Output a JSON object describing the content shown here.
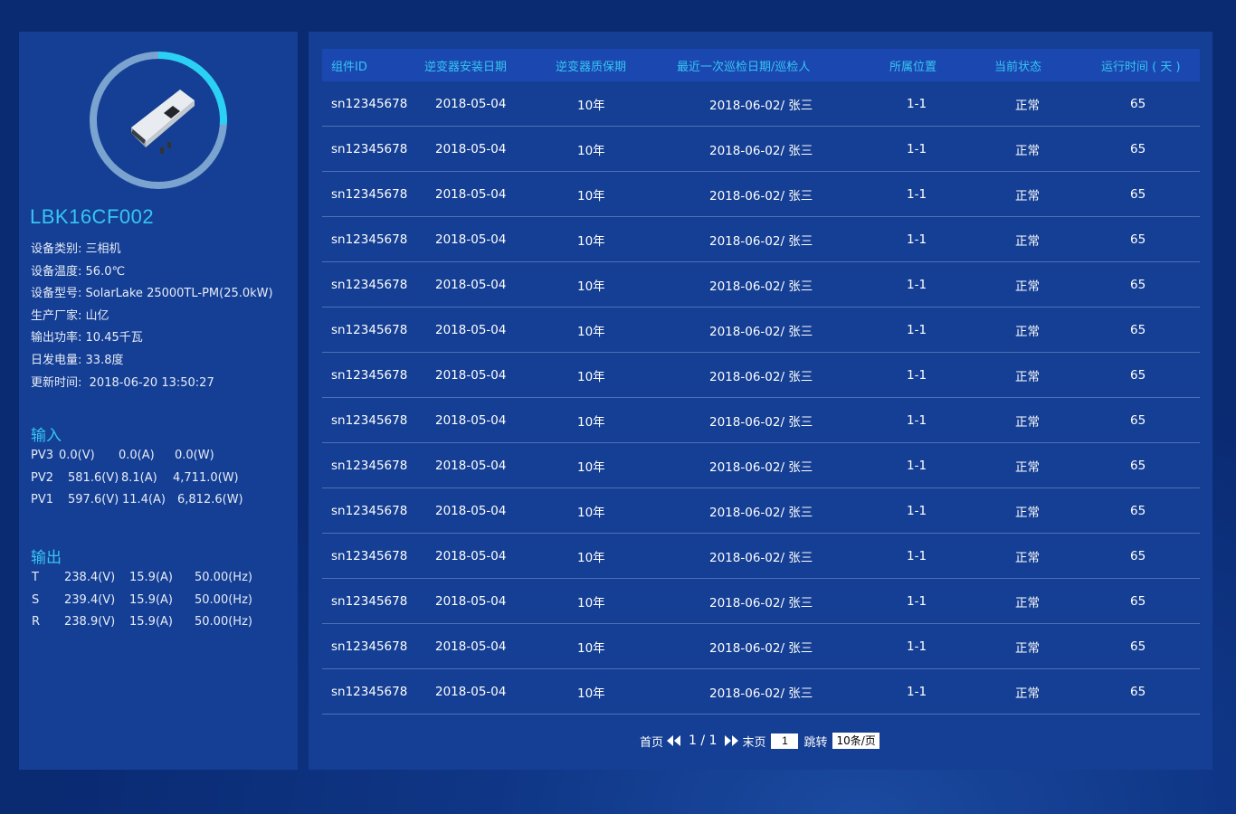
{
  "device": {
    "name": "LBK16CF002",
    "info": [
      {
        "label": "设备类别:",
        "value": "三相机"
      },
      {
        "label": "设备温度:",
        "value": "56.0℃"
      },
      {
        "label": "设备型号:",
        "value": "SolarLake 25000TL-PM(25.0kW)"
      },
      {
        "label": "生产厂家:",
        "value": "山亿"
      },
      {
        "label": "输出功率:",
        "value": "10.45千瓦"
      },
      {
        "label": "日发电量:",
        "value": "33.8度"
      },
      {
        "label": "更新时间:",
        "value": "2018-06-20 13:50:27"
      }
    ],
    "ring_progress_fraction": 0.26
  },
  "input": {
    "title": "输入",
    "rows": [
      {
        "name": "PV3",
        "v": "0.0(V)",
        "a": "0.0(A)",
        "w": "0.0(W)"
      },
      {
        "name": "PV2",
        "v": "581.6(V)",
        "a": "8.1(A)",
        "w": "4,711.0(W)"
      },
      {
        "name": "PV1",
        "v": "597.6(V)",
        "a": "11.4(A)",
        "w": "6,812.6(W)"
      }
    ]
  },
  "output": {
    "title": "输出",
    "rows": [
      {
        "name": "T",
        "v": "238.4(V)",
        "a": "15.9(A)",
        "hz": "50.00(Hz)"
      },
      {
        "name": "S",
        "v": "239.4(V)",
        "a": "15.9(A)",
        "hz": "50.00(Hz)"
      },
      {
        "name": "R",
        "v": "238.9(V)",
        "a": "15.9(A)",
        "hz": "50.00(Hz)"
      }
    ]
  },
  "table": {
    "headers": [
      "组件ID",
      "逆变器安装日期",
      "逆变器质保期",
      "最近一次巡检日期/巡检人",
      "所属位置",
      "当前状态",
      "运行时间 ( 天 )"
    ],
    "rows": [
      [
        "sn12345678",
        "2018-05-04",
        "10年",
        "2018-06-02/ 张三",
        "1-1",
        "正常",
        "65"
      ],
      [
        "sn12345678",
        "2018-05-04",
        "10年",
        "2018-06-02/ 张三",
        "1-1",
        "正常",
        "65"
      ],
      [
        "sn12345678",
        "2018-05-04",
        "10年",
        "2018-06-02/ 张三",
        "1-1",
        "正常",
        "65"
      ],
      [
        "sn12345678",
        "2018-05-04",
        "10年",
        "2018-06-02/ 张三",
        "1-1",
        "正常",
        "65"
      ],
      [
        "sn12345678",
        "2018-05-04",
        "10年",
        "2018-06-02/ 张三",
        "1-1",
        "正常",
        "65"
      ],
      [
        "sn12345678",
        "2018-05-04",
        "10年",
        "2018-06-02/ 张三",
        "1-1",
        "正常",
        "65"
      ],
      [
        "sn12345678",
        "2018-05-04",
        "10年",
        "2018-06-02/ 张三",
        "1-1",
        "正常",
        "65"
      ],
      [
        "sn12345678",
        "2018-05-04",
        "10年",
        "2018-06-02/ 张三",
        "1-1",
        "正常",
        "65"
      ],
      [
        "sn12345678",
        "2018-05-04",
        "10年",
        "2018-06-02/ 张三",
        "1-1",
        "正常",
        "65"
      ],
      [
        "sn12345678",
        "2018-05-04",
        "10年",
        "2018-06-02/ 张三",
        "1-1",
        "正常",
        "65"
      ],
      [
        "sn12345678",
        "2018-05-04",
        "10年",
        "2018-06-02/ 张三",
        "1-1",
        "正常",
        "65"
      ],
      [
        "sn12345678",
        "2018-05-04",
        "10年",
        "2018-06-02/ 张三",
        "1-1",
        "正常",
        "65"
      ],
      [
        "sn12345678",
        "2018-05-04",
        "10年",
        "2018-06-02/ 张三",
        "1-1",
        "正常",
        "65"
      ],
      [
        "sn12345678",
        "2018-05-04",
        "10年",
        "2018-06-02/ 张三",
        "1-1",
        "正常",
        "65"
      ]
    ]
  },
  "pager": {
    "first_label": "首页",
    "page_info": "1 / 1",
    "last_label": "末页",
    "page_input_value": "1",
    "jump_label": "跳转",
    "page_size": "10条/页",
    "prev_icon": "double-left-arrow-icon",
    "next_icon": "double-right-arrow-icon"
  },
  "colors": {
    "accent": "#37c6f3",
    "panel": "#153f94",
    "header": "#1a47b0",
    "ring_active": "#2ad1f4",
    "ring_rest": "#7aa3cf"
  }
}
